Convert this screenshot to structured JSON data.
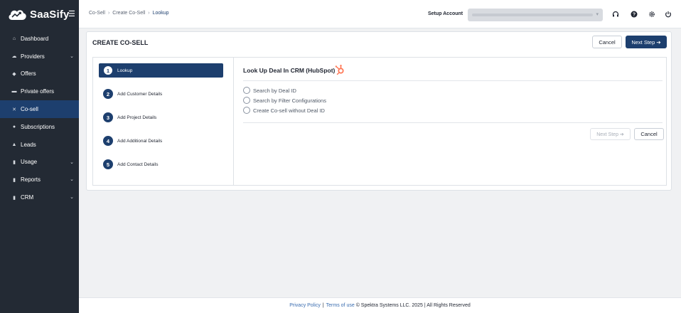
{
  "app": {
    "name": "SaaSify"
  },
  "sidebar": {
    "items": [
      {
        "label": "Dashboard",
        "icon": "home-icon",
        "glyph": "⌂",
        "chevron": false,
        "active": false
      },
      {
        "label": "Providers",
        "icon": "cloud-icon",
        "glyph": "☁",
        "chevron": true,
        "active": false
      },
      {
        "label": "Offers",
        "icon": "tag-icon",
        "glyph": "◆",
        "chevron": false,
        "active": false
      },
      {
        "label": "Private offers",
        "icon": "handshake-icon",
        "glyph": "▬",
        "chevron": false,
        "active": false
      },
      {
        "label": "Co-sell",
        "icon": "co-sell-icon",
        "glyph": "✕",
        "chevron": false,
        "active": true
      },
      {
        "label": "Subscriptions",
        "icon": "subscriptions-icon",
        "glyph": "●",
        "chevron": false,
        "active": false
      },
      {
        "label": "Leads",
        "icon": "users-icon",
        "glyph": "▲",
        "chevron": false,
        "active": false
      },
      {
        "label": "Usage",
        "icon": "bar-chart-icon",
        "glyph": "▮",
        "chevron": true,
        "active": false
      },
      {
        "label": "Reports",
        "icon": "line-chart-icon",
        "glyph": "▮",
        "chevron": true,
        "active": false
      },
      {
        "label": "CRM",
        "icon": "crm-icon",
        "glyph": "▮",
        "chevron": true,
        "active": false
      }
    ]
  },
  "topbar": {
    "breadcrumb": [
      "Co-Sell",
      "Create Co-Sell",
      "Lookup"
    ],
    "setup_account_label": "Setup Account",
    "icons": [
      "headset-icon",
      "help-icon",
      "settings-icon",
      "power-icon"
    ]
  },
  "page": {
    "title": "CREATE CO-SELL",
    "cancel_label": "Cancel",
    "next_label": "Next Step ➔"
  },
  "steps": [
    {
      "num": "1",
      "label": "Lookup",
      "active": true
    },
    {
      "num": "2",
      "label": "Add Customer Details",
      "active": false
    },
    {
      "num": "3",
      "label": "Add Project Details",
      "active": false
    },
    {
      "num": "4",
      "label": "Add Additional Details",
      "active": false
    },
    {
      "num": "5",
      "label": "Add Contact Details",
      "active": false
    }
  ],
  "lookup": {
    "title": "Look Up Deal In CRM (HubSpot)",
    "brand_color": "#ff7a59",
    "options": [
      "Search by Deal ID",
      "Search by Filter Configurations",
      "Create Co-sell without Deal ID"
    ],
    "next_label": "Next Step ➔",
    "cancel_label": "Cancel"
  },
  "footer": {
    "privacy": "Privacy Policy",
    "separator": "|",
    "terms": "Terms of use",
    "copyright": "© Spektra Systems LLC. 2025 | All Rights Reserved"
  },
  "colors": {
    "primary": "#1d3f6e",
    "sidebar": "#232a34"
  }
}
